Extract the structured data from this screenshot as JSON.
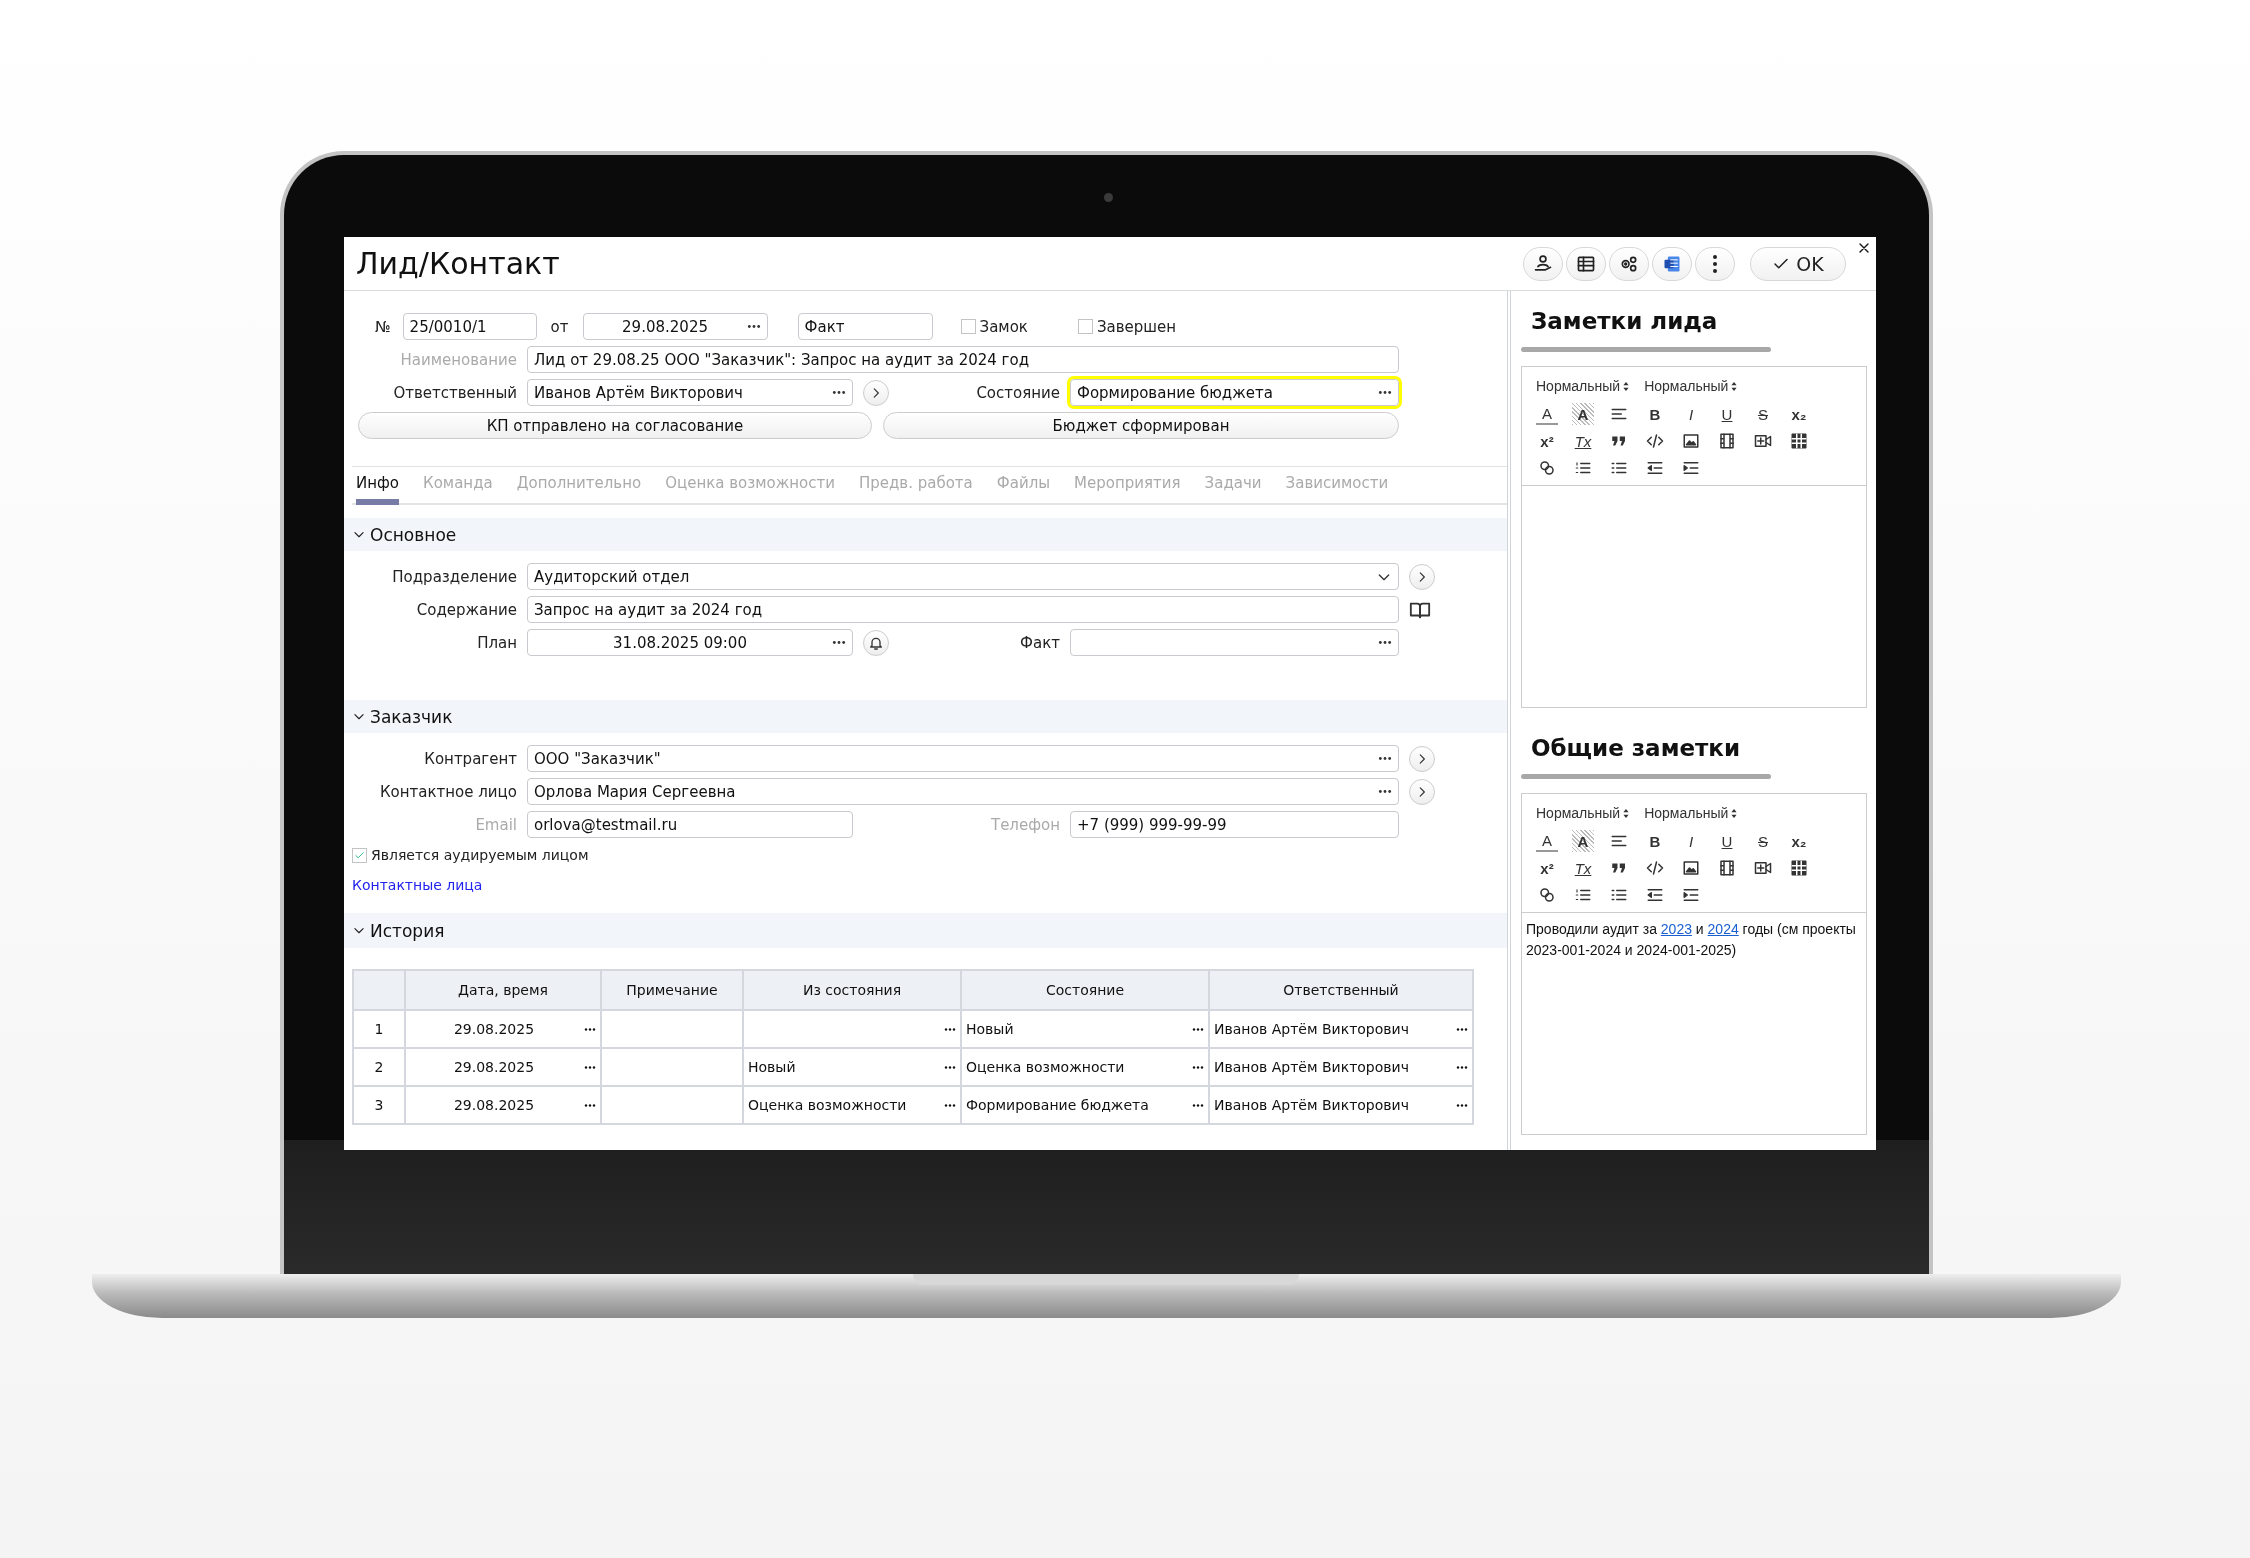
{
  "window": {
    "title": "Лид/Контакт",
    "ok_button": "OK"
  },
  "title_buttons": [
    {
      "kind": "person"
    },
    {
      "kind": "table"
    },
    {
      "kind": "gears"
    },
    {
      "kind": "doc"
    },
    {
      "kind": "more"
    }
  ],
  "header": {
    "number": {
      "label": "№",
      "value": "25/0010/1"
    },
    "date": {
      "label": "от",
      "value": "29.08.2025"
    },
    "mode": {
      "value": "Факт"
    },
    "flags": [
      {
        "label": "Замок",
        "checked": false
      },
      {
        "label": "Завершен",
        "checked": false
      }
    ],
    "rows": [
      {
        "fields": [
          {
            "label": "Наименование",
            "value": "Лид от 29.08.25 ООО \"Заказчик\": Запрос на аудит за 2024 год",
            "muted": true,
            "kind": "text"
          }
        ]
      },
      {
        "fields": [
          {
            "label": "Ответственный",
            "value": "Иванов Артём Викторович",
            "muted": false,
            "kind": "picker",
            "action": {
              "kind": "go"
            }
          },
          {
            "label": "Состояние",
            "value": "Формирование бюджета",
            "muted": false,
            "kind": "picker",
            "highlighted": true
          }
        ]
      }
    ],
    "actions": [
      "КП отправлено на согласование",
      "Бюджет сформирован"
    ]
  },
  "tabs": [
    {
      "label": "Инфо",
      "selected": true
    },
    {
      "label": "Команда",
      "selected": false
    },
    {
      "label": "Дополнительно",
      "selected": false
    },
    {
      "label": "Оценка возможности",
      "selected": false
    },
    {
      "label": "Предв. работа",
      "selected": false
    },
    {
      "label": "Файлы",
      "selected": false
    },
    {
      "label": "Мероприятия",
      "selected": false
    },
    {
      "label": "Задачи",
      "selected": false
    },
    {
      "label": "Зависимости",
      "selected": false
    }
  ],
  "sections": [
    {
      "title": "Основное",
      "expanded": true,
      "items": [
        {
          "kind": "row",
          "fields": [
            {
              "label": "Подразделение",
              "value": "Аудиторский отдел",
              "muted": false,
              "kind": "dropdown",
              "action": {
                "kind": "go"
              }
            }
          ]
        },
        {
          "kind": "row",
          "fields": [
            {
              "label": "Содержание",
              "value": "Запрос на аудит за 2024 год",
              "muted": false,
              "kind": "text",
              "action": {
                "kind": "book"
              }
            }
          ]
        },
        {
          "kind": "row",
          "fields": [
            {
              "label": "План",
              "value": "31.08.2025 09:00",
              "muted": false,
              "kind": "date",
              "action": {
                "kind": "bell"
              }
            },
            {
              "label": "Факт",
              "muted": false,
              "kind": "picker"
            }
          ]
        }
      ]
    },
    {
      "title": "Заказчик",
      "expanded": true,
      "items": [
        {
          "kind": "row",
          "fields": [
            {
              "label": "Контрагент",
              "value": "ООО \"Заказчик\"",
              "muted": false,
              "kind": "picker",
              "action": {
                "kind": "go"
              }
            }
          ]
        },
        {
          "kind": "row",
          "fields": [
            {
              "label": "Контактное лицо",
              "value": "Орлова Мария Сергеевна",
              "muted": false,
              "kind": "picker",
              "action": {
                "kind": "go"
              }
            }
          ]
        },
        {
          "kind": "row",
          "fields": [
            {
              "label": "Email",
              "value": "orlova@testmail.ru",
              "muted": true,
              "kind": "text"
            },
            {
              "label": "Телефон",
              "value": "+7 (999) 999-99-99",
              "muted": true,
              "kind": "text"
            }
          ]
        },
        {
          "kind": "checkbox",
          "label": "Является аудируемым лицом",
          "checked": true
        },
        {
          "kind": "link",
          "label": "Контактные лица"
        }
      ]
    },
    {
      "title": "История",
      "expanded": true,
      "items": [
        {
          "kind": "table",
          "columns": [
            "Дата, время",
            "Примечание",
            "Из состояния",
            "Состояние",
            "Ответственный"
          ],
          "rows": [
            {
              "number": "1",
              "date_time": "29.08.2025",
              "state": "Новый",
              "responsible": "Иванов Артём Викторович"
            },
            {
              "number": "2",
              "date_time": "29.08.2025",
              "from_state": "Новый",
              "state": "Оценка возможности",
              "responsible": "Иванов Артём Викторович"
            },
            {
              "number": "3",
              "date_time": "29.08.2025",
              "from_state": "Оценка возможности",
              "state": "Формирование бюджета",
              "responsible": "Иванов Артём Викторович"
            }
          ]
        }
      ]
    }
  ],
  "notes": [
    {
      "title": "Заметки лида",
      "selects": [
        "Нормальный",
        "Нормальный"
      ],
      "toolbar": [
        {
          "kind": "text-color",
          "label": "A"
        },
        {
          "kind": "highlight",
          "label": "A"
        },
        {
          "kind": "align"
        },
        {
          "kind": "bold",
          "label": "B"
        },
        {
          "kind": "italic",
          "label": "I"
        },
        {
          "kind": "underline",
          "label": "U"
        },
        {
          "kind": "strike",
          "label": "S"
        },
        {
          "kind": "subscript",
          "label": "x₂"
        },
        {
          "kind": "superscript",
          "label": "x²"
        },
        {
          "kind": "clear-format",
          "label": "Tx"
        },
        {
          "kind": "quote"
        },
        {
          "kind": "code"
        },
        {
          "kind": "image"
        },
        {
          "kind": "film"
        },
        {
          "kind": "video"
        },
        {
          "kind": "table"
        },
        {
          "kind": "link"
        },
        {
          "kind": "numbered-list"
        },
        {
          "kind": "bullet-list"
        },
        {
          "kind": "outdent"
        },
        {
          "kind": "indent"
        }
      ]
    },
    {
      "title": "Общие заметки",
      "selects": [
        "Нормальный",
        "Нормальный"
      ],
      "toolbar": [
        {
          "kind": "text-color",
          "label": "A"
        },
        {
          "kind": "highlight",
          "label": "A"
        },
        {
          "kind": "align"
        },
        {
          "kind": "bold",
          "label": "B"
        },
        {
          "kind": "italic",
          "label": "I"
        },
        {
          "kind": "underline",
          "label": "U"
        },
        {
          "kind": "strike",
          "label": "S"
        },
        {
          "kind": "subscript",
          "label": "x₂"
        },
        {
          "kind": "superscript",
          "label": "x²"
        },
        {
          "kind": "clear-format",
          "label": "Tx"
        },
        {
          "kind": "quote"
        },
        {
          "kind": "code"
        },
        {
          "kind": "image"
        },
        {
          "kind": "film"
        },
        {
          "kind": "video"
        },
        {
          "kind": "table"
        },
        {
          "kind": "link"
        },
        {
          "kind": "numbered-list"
        },
        {
          "kind": "bullet-list"
        },
        {
          "kind": "outdent"
        },
        {
          "kind": "indent"
        }
      ],
      "content": [
        {
          "kind": "text",
          "text": "Проводили аудит за "
        },
        {
          "kind": "link",
          "text": "2023"
        },
        {
          "kind": "text",
          "text": " и "
        },
        {
          "kind": "link",
          "text": "2024"
        },
        {
          "kind": "text",
          "text": " годы (см проекты 2023-001-2024 и 2024-001-2025)"
        }
      ]
    }
  ]
}
